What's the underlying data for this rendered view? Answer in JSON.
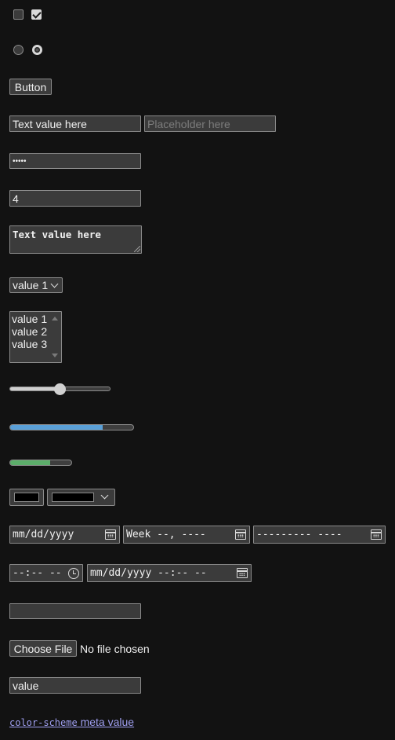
{
  "checkboxes": [
    {
      "checked": false
    },
    {
      "checked": true
    }
  ],
  "radios": [
    {
      "checked": false
    },
    {
      "checked": true
    }
  ],
  "button": {
    "label": "Button"
  },
  "text_input": {
    "value": "Text value here"
  },
  "placeholder_input": {
    "placeholder": "Placeholder here"
  },
  "password_input": {
    "masked_value": "•••••"
  },
  "number_input": {
    "value": "4"
  },
  "textarea": {
    "value": "Text value here"
  },
  "select": {
    "selected": "value 1"
  },
  "listbox": {
    "options": [
      "value 1",
      "value 2",
      "value 3"
    ]
  },
  "range_slider": {
    "value_fraction": 0.5
  },
  "progress_bar": {
    "value_fraction": 0.75,
    "color": "#5aa0d8"
  },
  "meter_bar": {
    "value_fraction": 0.65,
    "color": "#5cad6a"
  },
  "color_input": {
    "value": "#000000"
  },
  "color_select": {
    "value": "#000000"
  },
  "date_input": {
    "text": "mm/dd/yyyy"
  },
  "week_input": {
    "text": "Week --, ----"
  },
  "month_input": {
    "text": "--------- ----"
  },
  "time_input": {
    "text": "--:-- --"
  },
  "datetime_input": {
    "text": "mm/dd/yyyy --:-- --"
  },
  "empty_input": {
    "value": ""
  },
  "file_input": {
    "button_label": "Choose File",
    "status": "No file chosen"
  },
  "value_input": {
    "value": "value"
  },
  "link": {
    "code_text": "color-scheme",
    "text": " meta value"
  },
  "icons": [
    "checkmark-icon",
    "chevron-down-icon",
    "calendar-icon",
    "clock-icon",
    "resize-grip-icon"
  ]
}
